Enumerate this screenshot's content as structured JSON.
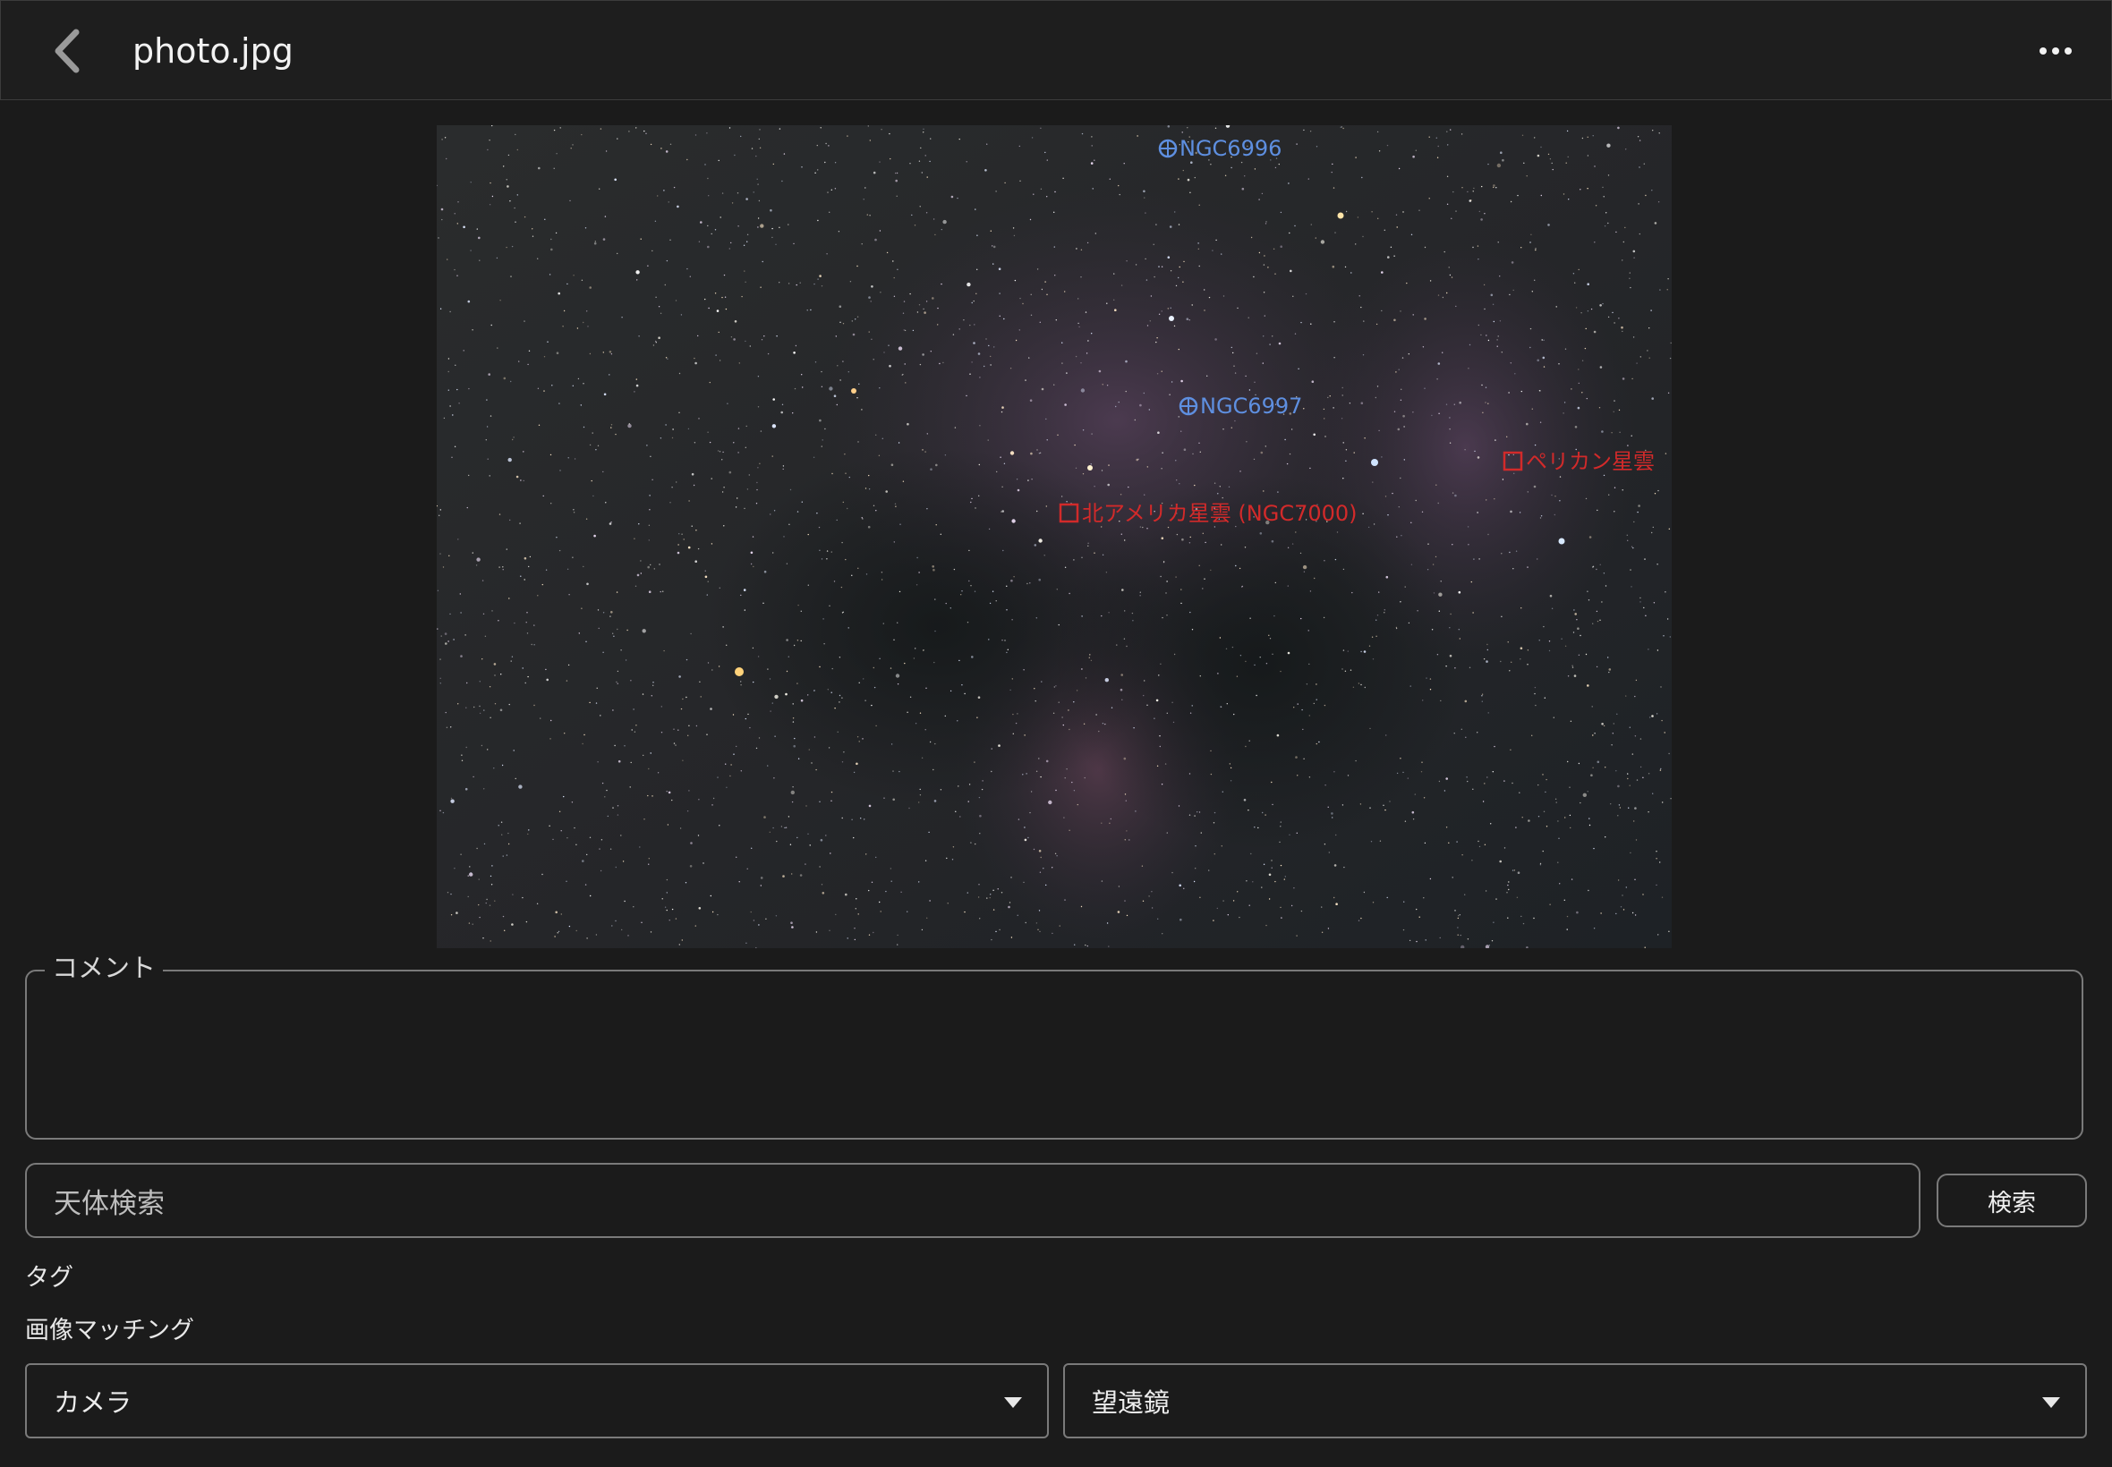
{
  "header": {
    "title": "photo.jpg",
    "back_icon": "chevron-left-icon",
    "more_icon": "more-horizontal-icon"
  },
  "photo": {
    "annotations": [
      {
        "label": "NGC6996",
        "marker": "crosshair-circle",
        "color": "#5e8fe0"
      },
      {
        "label": "NGC6997",
        "marker": "crosshair-circle",
        "color": "#5e8fe0"
      },
      {
        "label": "ペリカン星雲",
        "marker": "square",
        "color": "#d22a2a"
      },
      {
        "label": "北アメリカ星雲 (NGC7000)",
        "marker": "square",
        "color": "#d22a2a"
      }
    ]
  },
  "comment": {
    "label": "コメント",
    "value": ""
  },
  "search": {
    "placeholder": "天体検索",
    "button_label": "検索"
  },
  "tags": {
    "label": "タグ"
  },
  "matching": {
    "label": "画像マッチング"
  },
  "selects": {
    "camera": "カメラ",
    "telescope": "望遠鏡"
  },
  "colors": {
    "background": "#1b1b1b",
    "border": "#7a7a7a",
    "annotation_blue": "#5e8fe0",
    "annotation_red": "#d22a2a"
  }
}
